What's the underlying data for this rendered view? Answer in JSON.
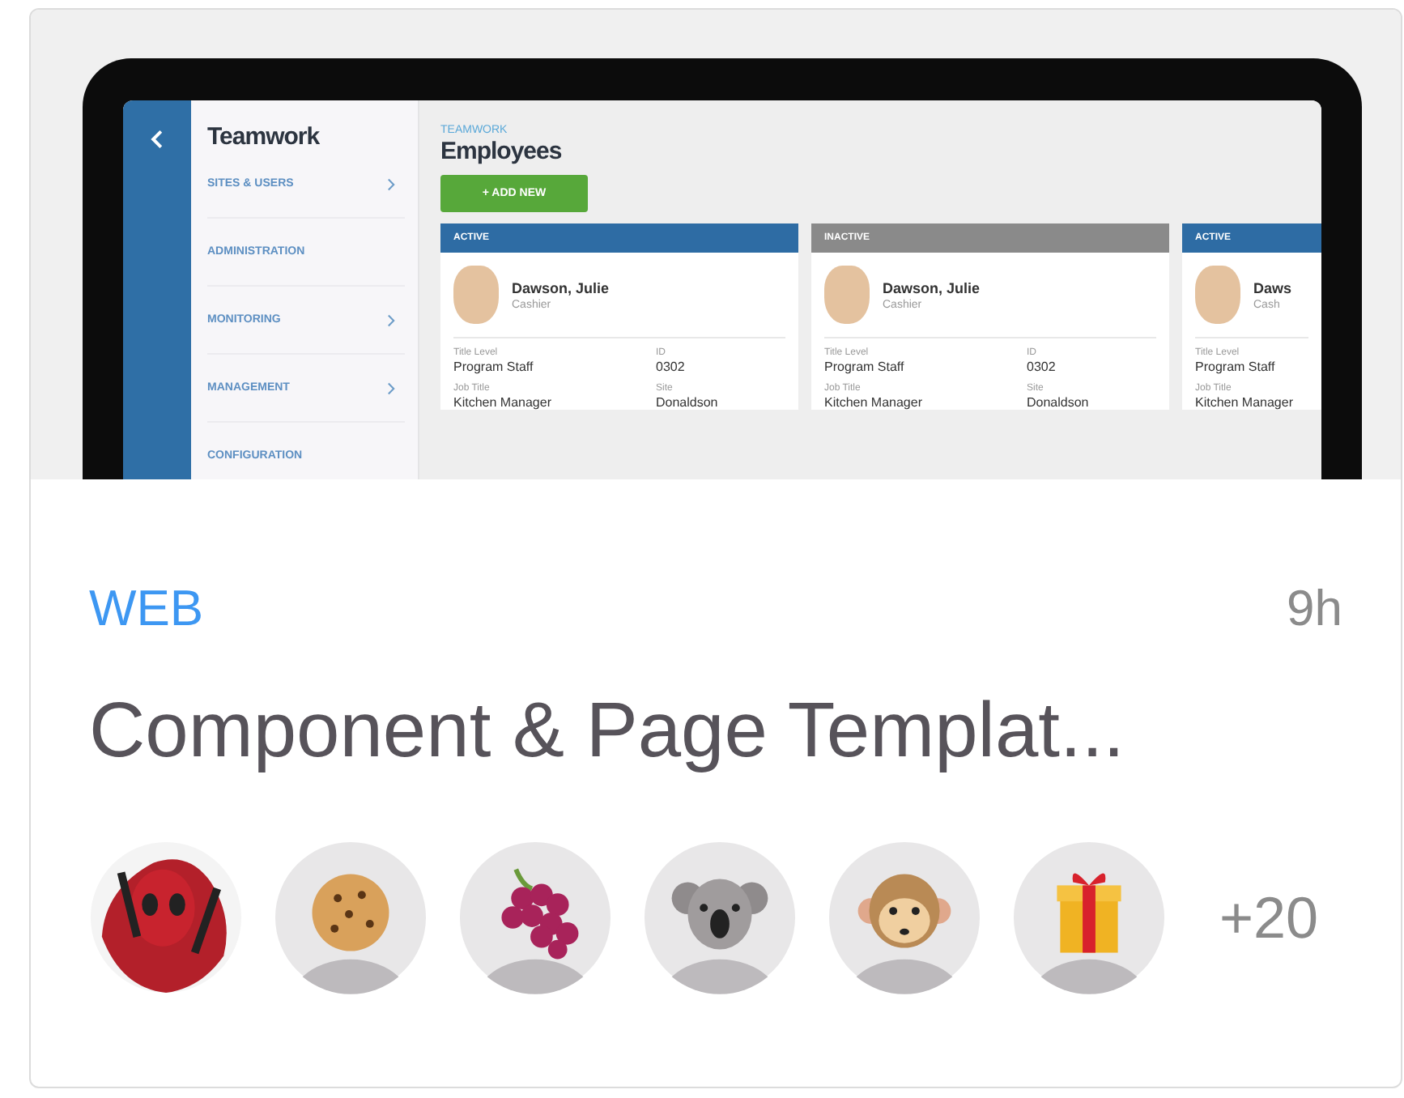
{
  "preview": {
    "sidebar": {
      "title": "Teamwork",
      "items": [
        {
          "label": "SITES & USERS",
          "has_submenu": true
        },
        {
          "label": "ADMINISTRATION",
          "has_submenu": false
        },
        {
          "label": "MONITORING",
          "has_submenu": true
        },
        {
          "label": "MANAGEMENT",
          "has_submenu": true
        },
        {
          "label": "CONFIGURATION",
          "has_submenu": false
        }
      ]
    },
    "breadcrumb": "TEAMWORK",
    "heading": "Employees",
    "add_button": "+ ADD NEW",
    "employees": [
      {
        "status": "ACTIVE",
        "kind": "active",
        "name": "Dawson, Julie",
        "role": "Cashier",
        "rows": [
          [
            {
              "label": "Title Level",
              "value": "Program Staff"
            },
            {
              "label": "ID",
              "value": "0302"
            }
          ],
          [
            {
              "label": "Job Title",
              "value": "Kitchen Manager"
            },
            {
              "label": "Site",
              "value": "Donaldson"
            }
          ]
        ]
      },
      {
        "status": "INACTIVE",
        "kind": "inactive",
        "name": "Dawson, Julie",
        "role": "Cashier",
        "rows": [
          [
            {
              "label": "Title Level",
              "value": "Program Staff"
            },
            {
              "label": "ID",
              "value": "0302"
            }
          ],
          [
            {
              "label": "Job Title",
              "value": "Kitchen Manager"
            },
            {
              "label": "Site",
              "value": "Donaldson"
            }
          ]
        ]
      },
      {
        "status": "ACTIVE",
        "kind": "active",
        "name": "Daws",
        "role": "Cash",
        "rows": [
          [
            {
              "label": "Title Level",
              "value": "Program Staff"
            }
          ],
          [
            {
              "label": "Job Title",
              "value": "Kitchen Manager"
            }
          ]
        ]
      }
    ]
  },
  "category": "WEB",
  "age": "9h",
  "title": "Component & Page Templat...",
  "members_more": "+20"
}
